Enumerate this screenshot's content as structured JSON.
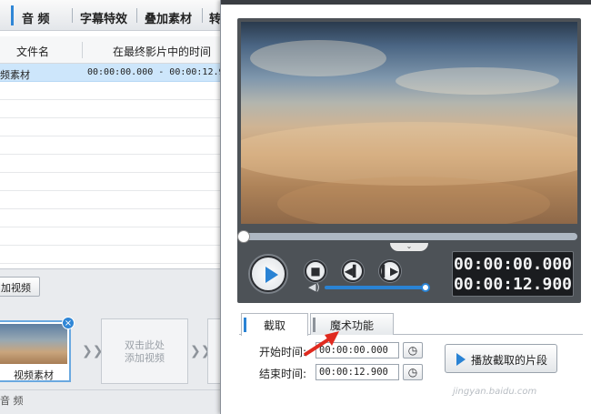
{
  "main": {
    "tabs": [
      {
        "label": "音  频"
      },
      {
        "label": "字幕特效"
      },
      {
        "label": "叠加素材"
      },
      {
        "label": "转"
      }
    ],
    "table": {
      "headers": [
        "文件名",
        "在最终影片中的时间"
      ],
      "rows": [
        {
          "name": "频素材",
          "time": "00:00:00.000 - 00:00:12.9"
        }
      ]
    },
    "add_video_button": "加视频",
    "timeline": {
      "clip_label": "视频素材",
      "placeholder": "双击此处\n添加视频",
      "audio_track_label": "音  频"
    }
  },
  "panel": {
    "time_current": "00:00:00.000",
    "time_total": "00:00:12.900",
    "seek_progress": 0,
    "volume_level": 1,
    "tabs": [
      {
        "label": "截取"
      },
      {
        "label": "魔术功能"
      }
    ],
    "start_label": "开始时间:",
    "start_value": "00:00:00.000",
    "end_label": "结束时间:",
    "end_value": "00:00:12.900",
    "play_segment_button": "播放截取的片段",
    "watermark": "jingyan.baidu.com"
  },
  "colors": {
    "accent": "#2a83d4",
    "selected_row": "#cde6fb",
    "player_bg": "#4d5257",
    "arrow_red": "#e02a1f"
  },
  "icons": {
    "play": "play-icon",
    "stop": "stop-icon",
    "prev": "prev-frame-icon",
    "next": "next-frame-icon",
    "speaker": "speaker-icon",
    "reset_time": "clock-reset-icon",
    "close": "close-icon"
  }
}
